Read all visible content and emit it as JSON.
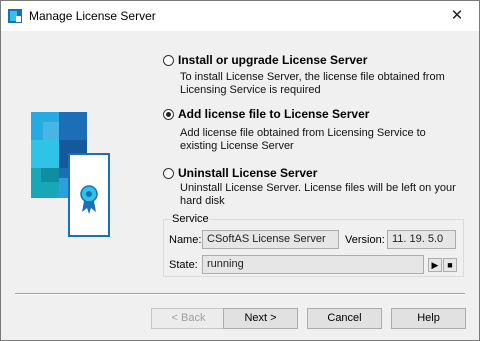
{
  "window": {
    "title": "Manage License Server",
    "close_icon": "close-icon"
  },
  "options": [
    {
      "label": "Install or upgrade License Server",
      "description": "To install License Server, the license file obtained from Licensing Service is required",
      "checked": false
    },
    {
      "label": "Add license file to License Server",
      "description": "Add license file obtained from Licensing Service to existing License Server",
      "checked": true
    },
    {
      "label": "Uninstall License Server",
      "description": "Uninstall License Server. License files will be left on your hard disk",
      "checked": false
    }
  ],
  "service": {
    "legend": "Service",
    "name_label": "Name:",
    "name_value": "CSoftAS License Server",
    "version_label": "Version:",
    "version_value": "11. 19. 5.0",
    "state_label": "State:",
    "state_value": "running",
    "start_icon": "play-icon",
    "stop_icon": "stop-icon"
  },
  "buttons": {
    "back": "< Back",
    "next": "Next >",
    "cancel": "Cancel",
    "help": "Help"
  },
  "colors": {
    "accent_dark": "#1c6fb7",
    "accent_mid": "#2b9fe0",
    "accent_light": "#30c3e8",
    "accent_teal": "#18a7b9"
  }
}
